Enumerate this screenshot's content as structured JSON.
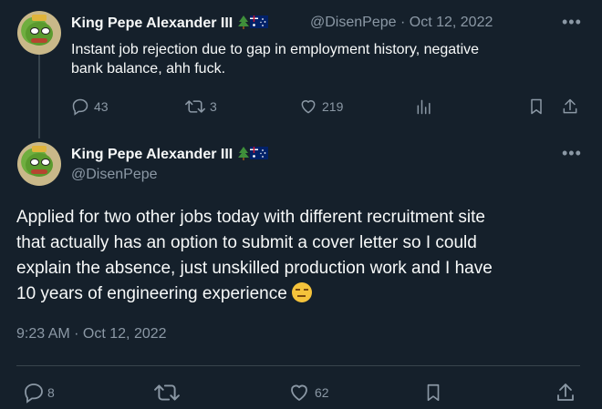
{
  "tweet1": {
    "name": "King Pepe Alexander III",
    "handle": "@DisenPepe",
    "date": "· Oct 12, 2022",
    "text_line1": "Instant job rejection due to gap in employment history, negative",
    "text_line2": "bank balance, ahh fuck.",
    "replies": "43",
    "retweets": "3",
    "likes": "219"
  },
  "tweet2": {
    "name": "King Pepe Alexander III",
    "handle": "@DisenPepe",
    "text_lines": [
      "Applied for two other jobs today with different recruitment site",
      "that actually has an option to submit a cover letter so I could",
      "explain the absence, just unskilled production work and I have",
      "10 years of engineering experience"
    ],
    "timestamp": "9:23 AM · Oct 12, 2022",
    "replies": "8",
    "likes": "62"
  },
  "colors": {
    "background": "#15202b",
    "text": "#f7f9f9",
    "muted": "#8b98a5",
    "divider": "#38444d"
  }
}
